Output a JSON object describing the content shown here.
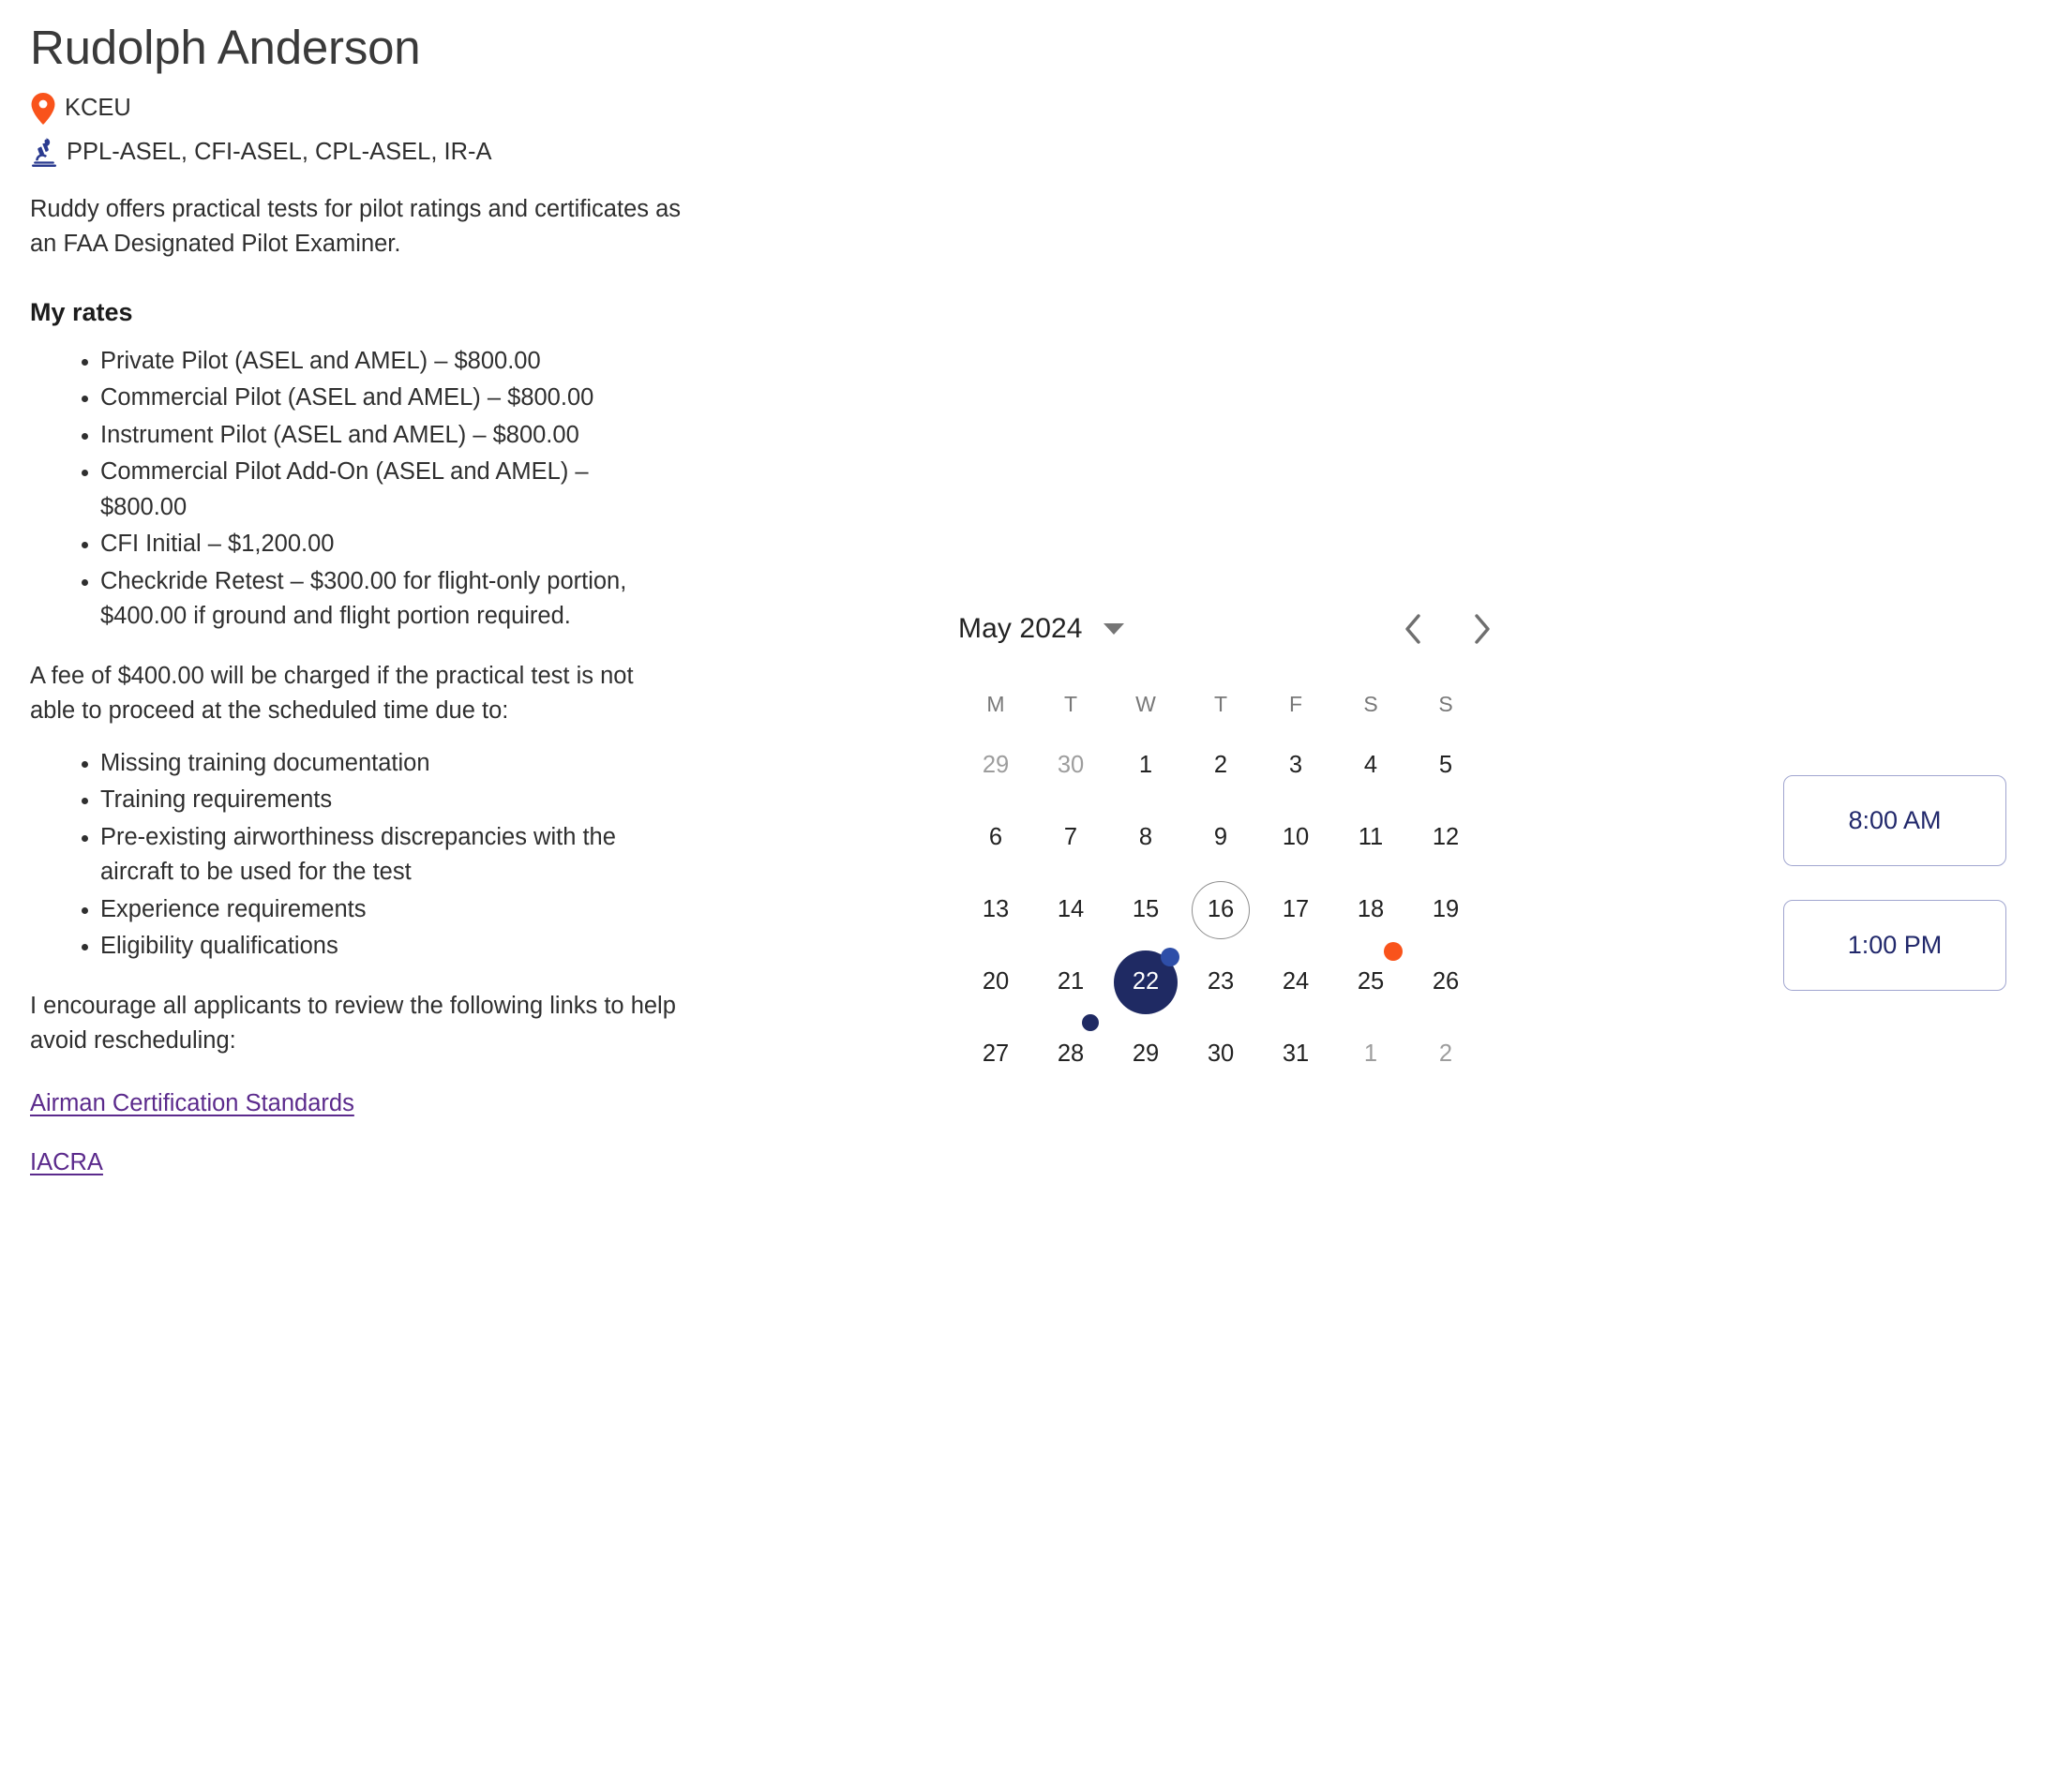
{
  "profile": {
    "name": "Rudolph Anderson",
    "location": "KCEU",
    "location_icon": "map-pin-icon",
    "certifications": "PPL-ASEL, CFI-ASEL, CPL-ASEL, IR-A",
    "certifications_icon": "microscope-icon",
    "intro": "Ruddy offers practical tests for pilot ratings and certificates as an FAA Designated Pilot Examiner.",
    "rates_heading": "My rates",
    "rates": [
      "Private Pilot (ASEL and AMEL) – $800.00",
      "Commercial Pilot (ASEL and AMEL) – $800.00",
      "Instrument Pilot (ASEL and AMEL) – $800.00",
      "Commercial Pilot Add-On (ASEL and AMEL) – $800.00",
      "CFI Initial – $1,200.00",
      "Checkride Retest – $300.00 for flight-only portion, $400.00 if ground and flight portion required."
    ],
    "fee_note": "A fee of $400.00 will be charged if the practical test is not able to proceed at the scheduled time due to:",
    "fee_reasons": [
      "Missing training documentation",
      "Training requirements",
      "Pre-existing airworthiness discrepancies with the aircraft to be used for the test",
      "Experience requirements",
      "Eligibility qualifications"
    ],
    "links_intro": "I encourage all applicants to review the following links to help avoid rescheduling:",
    "links": [
      {
        "label": "Airman Certification Standards"
      },
      {
        "label": "IACRA"
      }
    ]
  },
  "calendar": {
    "month_label": "May 2024",
    "caret_icon": "chevron-down-icon",
    "prev_icon": "chevron-left-icon",
    "next_icon": "chevron-right-icon",
    "day_initials": [
      "M",
      "T",
      "W",
      "T",
      "F",
      "S",
      "S"
    ],
    "weeks": [
      [
        {
          "n": "29",
          "state": "muted"
        },
        {
          "n": "30",
          "state": "muted"
        },
        {
          "n": "1",
          "state": "normal"
        },
        {
          "n": "2",
          "state": "normal"
        },
        {
          "n": "3",
          "state": "normal"
        },
        {
          "n": "4",
          "state": "normal"
        },
        {
          "n": "5",
          "state": "normal"
        }
      ],
      [
        {
          "n": "6",
          "state": "normal"
        },
        {
          "n": "7",
          "state": "normal"
        },
        {
          "n": "8",
          "state": "normal"
        },
        {
          "n": "9",
          "state": "normal"
        },
        {
          "n": "10",
          "state": "normal"
        },
        {
          "n": "11",
          "state": "normal"
        },
        {
          "n": "12",
          "state": "normal"
        }
      ],
      [
        {
          "n": "13",
          "state": "normal"
        },
        {
          "n": "14",
          "state": "normal"
        },
        {
          "n": "15",
          "state": "normal"
        },
        {
          "n": "16",
          "state": "today"
        },
        {
          "n": "17",
          "state": "normal"
        },
        {
          "n": "18",
          "state": "normal"
        },
        {
          "n": "19",
          "state": "normal"
        }
      ],
      [
        {
          "n": "20",
          "state": "normal"
        },
        {
          "n": "21",
          "state": "normal"
        },
        {
          "n": "22",
          "state": "selected",
          "dot": "blue-lg"
        },
        {
          "n": "23",
          "state": "normal"
        },
        {
          "n": "24",
          "state": "normal"
        },
        {
          "n": "25",
          "state": "normal",
          "dot": "orange"
        },
        {
          "n": "26",
          "state": "normal"
        }
      ],
      [
        {
          "n": "27",
          "state": "normal"
        },
        {
          "n": "28",
          "state": "normal",
          "dot": "blue-sm"
        },
        {
          "n": "29",
          "state": "normal"
        },
        {
          "n": "30",
          "state": "normal"
        },
        {
          "n": "31",
          "state": "normal"
        },
        {
          "n": "1",
          "state": "muted"
        },
        {
          "n": "2",
          "state": "muted"
        }
      ]
    ]
  },
  "time_slots": [
    {
      "label": "8:00 AM"
    },
    {
      "label": "1:00 PM"
    }
  ],
  "colors": {
    "accent_orange": "#F9531B",
    "accent_navy": "#1F2A63",
    "link_purple": "#5B2A8C",
    "slot_border": "#A0A5CF",
    "dot_blue": "#2E4EA8"
  }
}
